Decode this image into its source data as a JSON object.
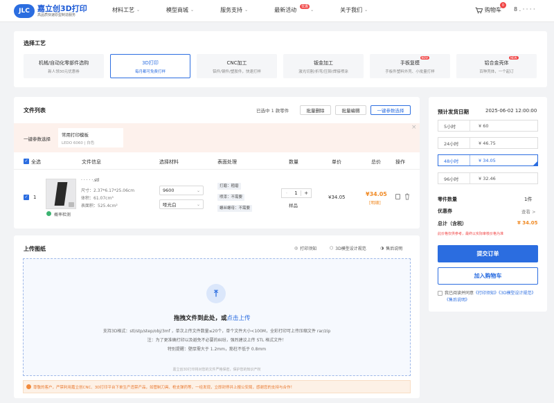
{
  "header": {
    "logo_badge": "JLC",
    "logo_main": "嘉立创3D打印",
    "logo_sub": "高品质快速原型制造服务",
    "nav": [
      {
        "label": "材料工艺",
        "has_dropdown": true
      },
      {
        "label": "模型商城",
        "has_dropdown": true
      },
      {
        "label": "服务支持",
        "has_dropdown": true
      },
      {
        "label": "最新活动",
        "has_dropdown": true,
        "badge": "优惠"
      },
      {
        "label": "关于我们",
        "has_dropdown": true
      }
    ],
    "cart_label": "购物车",
    "cart_count": "0",
    "user_text": "8 . · · · ·"
  },
  "process": {
    "title": "选择工艺",
    "tabs": [
      {
        "title": "机械/自动化零部件选购",
        "subtitle": "新人领30元优惠券",
        "active": false
      },
      {
        "title": "3D打印",
        "subtitle": "每月都可免费打样",
        "active": true
      },
      {
        "title": "CNC加工",
        "subtitle": "铝件/钢件/塑胶件，快速打样",
        "active": false
      },
      {
        "title": "钣金加工",
        "subtitle": "激光切割/折弯/压铆/焊接喷涂",
        "active": false
      },
      {
        "title": "手板复模",
        "subtitle": "手板件塑料外壳、小批量打样",
        "tag": "NEW",
        "active": false
      },
      {
        "title": "铝合金壳体",
        "subtitle": "百种壳体，一个起订",
        "tag": "NEW",
        "active": false
      }
    ]
  },
  "file_list": {
    "title": "文件列表",
    "selected_text": "已选中 1 款零件",
    "btn_batch_delete": "批量删除",
    "btn_batch_edit": "批量编辑",
    "btn_one_click": "一键参数选择",
    "param_label": "一键参数选择",
    "template_name": "常用打印模板",
    "template_desc": "LEDO 6060 | 白色",
    "columns": {
      "select_all": "全选",
      "file_info": "文件信息",
      "material": "选择材料",
      "surface": "表面处理",
      "quantity": "数量",
      "unit_price": "单价",
      "total_price": "总价",
      "action": "操作"
    },
    "row": {
      "index": "1",
      "file_name": "· · · · ·.stl",
      "size": "尺寸：2.37*6.17*25.06cm",
      "volume": "体积：61.07cm³",
      "area": "表面积：525.4cm²",
      "detect_status": "概率检测",
      "material": "9600",
      "color": "哑光白",
      "surface": [
        "打磨：粗磨",
        "喷漆：不需要",
        "螺丝螺母：不需要"
      ],
      "quantity": "1",
      "quantity_minus": "-",
      "quantity_plus": "+",
      "sample_label": "样品",
      "unit_price": "¥34.05",
      "total_price": "¥34.05",
      "detail_link": "[明细]"
    }
  },
  "upload": {
    "title": "上传图纸",
    "links": [
      "打印须知",
      "3D模型设计规范",
      "售后说明"
    ],
    "main_text": "拖拽文件到此处，或",
    "main_link": "点击上传",
    "formats": "支持3D格式：stl/stp/step/obj/3mf ，单次上传文件数量≤20个，单个文件大小<100M，全彩打印可上传压缩文件 rar/zip",
    "note": "注：为了更准确打印以及避免不必要的纠纷，强烈建议上传 STL 格式文件！",
    "reminder": "特别提醒：壁厚需大于 1.2mm，筋柱不低于 0.8mm",
    "privacy": "嘉立创3D打印将对您的文件严格保密，保护您的知识产权",
    "notice": "尊敬的客户，严禁利用嘉立创CNC、3D打印平台下单生产违禁产品，如管制刀具、枪支弹药等，一经发现，立即封停并上报公安局，感谢您的支持与合作！"
  },
  "summary": {
    "ship_label": "预计发货日期",
    "ship_date": "2025-06-02 12:00:00",
    "options": [
      {
        "hours": "5小时",
        "price": "¥ 60",
        "active": false
      },
      {
        "hours": "24小时",
        "price": "¥ 46.75",
        "active": false
      },
      {
        "hours": "48小时",
        "price": "¥ 34.05",
        "active": true
      },
      {
        "hours": "96小时",
        "price": "¥ 32.46",
        "active": false
      }
    ],
    "parts_label": "零件数量",
    "parts_value": "1件",
    "coupon_label": "优惠券",
    "coupon_value": "查看 >",
    "total_label": "总计（含税）",
    "total_value": "¥ 34.05",
    "disclaimer": "此价格仅供参考，最终以实际审核价格为准",
    "submit_label": "提交订单",
    "add_cart_label": "加入购物车",
    "agree_prefix": "我已阅读并同意",
    "agree_links": [
      "《打印须知》",
      "《3D模型设计规范》",
      "《售后说明》"
    ]
  },
  "colors": {
    "primary": "#2b6de0",
    "price": "#f08a24",
    "danger": "#f04545"
  }
}
